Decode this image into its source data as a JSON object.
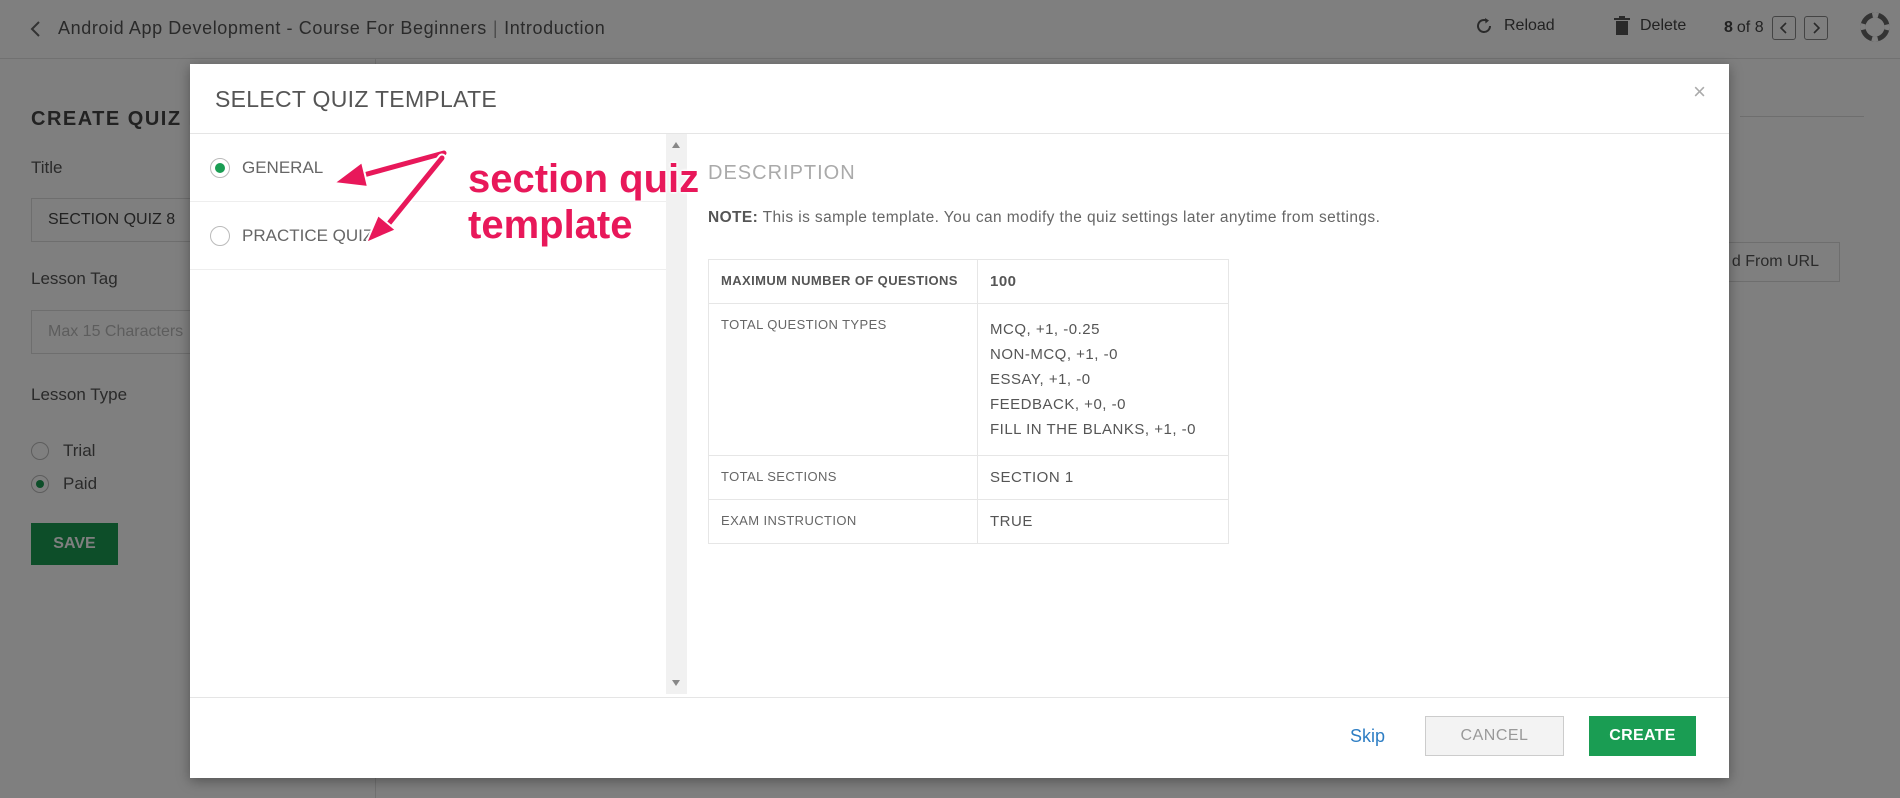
{
  "topbar": {
    "course": "Android App Development - Course For Beginners",
    "separator": "|",
    "section": "Introduction",
    "reload": "Reload",
    "delete": "Delete",
    "page_current": "8",
    "page_of": "of 8"
  },
  "background_form": {
    "heading": "CREATE QUIZ L",
    "title_label": "Title",
    "title_value": "SECTION QUIZ 8",
    "tag_label": "Lesson Tag",
    "tag_placeholder": "Max 15 Characters",
    "type_label": "Lesson Type",
    "type_options": [
      "Trial",
      "Paid"
    ],
    "type_selected": "Paid",
    "save": "SAVE",
    "url_button": "d From URL"
  },
  "modal": {
    "title": "SELECT QUIZ TEMPLATE",
    "close": "×",
    "templates": [
      {
        "label": "GENERAL",
        "selected": true
      },
      {
        "label": "PRACTICE QUIZ",
        "selected": false
      }
    ],
    "description": {
      "heading": "DESCRIPTION",
      "note_prefix": "NOTE:",
      "note_text": " This is sample template. You can modify the quiz settings later anytime from settings.",
      "rows": [
        {
          "key": "MAXIMUM NUMBER OF QUESTIONS",
          "value": "100"
        },
        {
          "key": "TOTAL QUESTION TYPES",
          "value_lines": [
            "MCQ,   +1,   -0.25",
            "NON-MCQ,   +1,   -0",
            "ESSAY,   +1,   -0",
            "FEEDBACK,   +0,   -0",
            "FILL IN THE BLANKS,   +1,   -0"
          ]
        },
        {
          "key": "TOTAL SECTIONS",
          "value": "SECTION 1"
        },
        {
          "key": "EXAM INSTRUCTION",
          "value": "TRUE"
        }
      ]
    },
    "footer": {
      "skip": "Skip",
      "cancel": "CANCEL",
      "create": "CREATE"
    }
  },
  "annotation": {
    "line1": "section quiz",
    "line2": "template",
    "color": "#e8185a"
  }
}
